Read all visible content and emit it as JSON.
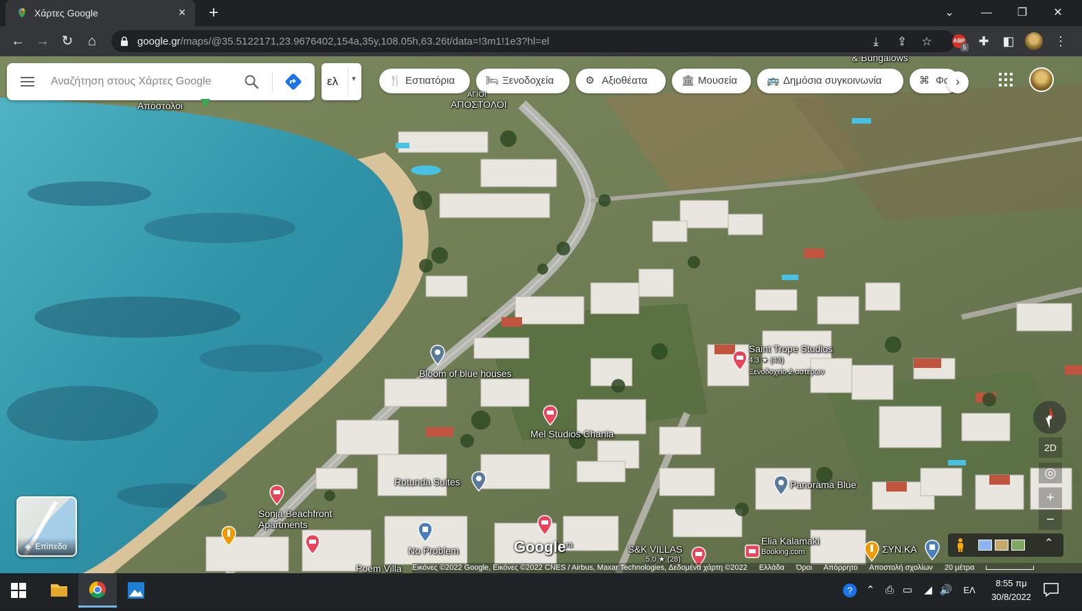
{
  "browser": {
    "tab_title": "Χάρτες Google",
    "url_host": "google.gr",
    "url_path": "/maps/@35.5122171,23.9676402,154a,35y,108.05h,63.26t/data=!3m1!1e3?hl=el",
    "extension_badge_count": "5"
  },
  "search": {
    "placeholder": "Αναζήτηση στους Χάρτες Google",
    "language": "ελ"
  },
  "chips": [
    {
      "icon": "restaurant-icon",
      "label": "Εστιατόρια"
    },
    {
      "icon": "hotel-icon",
      "label": "Ξενοδοχεία"
    },
    {
      "icon": "attractions-icon",
      "label": "Αξιοθέατα"
    },
    {
      "icon": "museum-icon",
      "label": "Μουσεία"
    },
    {
      "icon": "transit-icon",
      "label": "Δημόσια συγκοινωνία"
    },
    {
      "icon": "pharmacy-icon",
      "label": "Φα"
    }
  ],
  "map_labels": {
    "bungalows": "& Bungalows",
    "apostoloi_left": "Απόστολοι",
    "apostoloi_top_1": "ΑΓΙΟΙ",
    "apostoloi_top_2": "ΑΠΟΣΤΟΛΟΙ",
    "bloom": "Bloom of blue houses",
    "saint_trope": "Saint Trope Studios",
    "saint_trope_rating": "4,3 ★ (43)",
    "saint_trope_type": "Ξενοδοχείο 2 αστέρων",
    "mel_studios": "Mel Studios Chania",
    "rotunda": "Rotunda Suites",
    "panorama": "Panorama Blue",
    "sonja_1": "Sonja Beachfront",
    "sonja_2": "Apartments",
    "no_problem": "No Problem",
    "poem_villa": "Poem Villa",
    "sk_villas": "S&K VILLAS",
    "sk_rating": "5,0 ★ (28)",
    "elia_1": "Elia Kalamaki",
    "elia_2": "Booking.com",
    "syn_ka": "ΣΥΝ.ΚΑ",
    "tra": "ra"
  },
  "layers_label": "Επίπεδα",
  "controls": {
    "view_toggle": "2D",
    "zoom_in": "+",
    "zoom_out": "−"
  },
  "google_logo": "Google",
  "attribution": {
    "imagery": "Εικόνες ©2022 Google, Εικόνες ©2022 CNES / Airbus, Maxar Technologies, Δεδομένα χάρτη ©2022",
    "country": "Ελλάδα",
    "terms": "Όροι",
    "privacy": "Απόρρητο",
    "feedback": "Αποστολή σχολίων",
    "scale": "20 μέτρα"
  },
  "taskbar": {
    "time": "8:55 πμ",
    "date": "30/8/2022",
    "language": "ΕΛ"
  },
  "colors": {
    "sea": "#3a9bb0",
    "beach": "#d9c49a",
    "land": "#6f7d55",
    "pin_red": "#e8445a",
    "pin_blue": "#4a7ebf"
  }
}
